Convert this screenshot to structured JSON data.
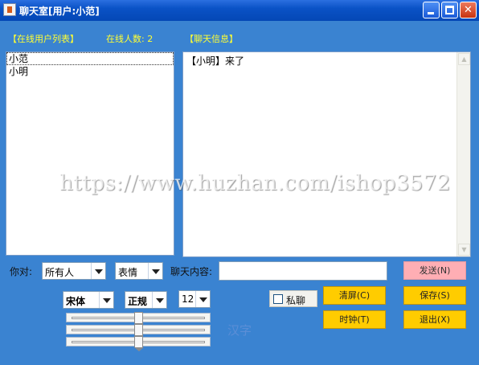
{
  "window": {
    "title": "聊天室[用户:小范]"
  },
  "labels": {
    "user_list": "【在线用户列表】",
    "online_count": "在线人数: 2",
    "chat_info": "【聊天信息】",
    "to": "你对:",
    "content": "聊天内容:"
  },
  "users": [
    "小范",
    "小明"
  ],
  "chat": {
    "text": "【小明】来了"
  },
  "watermark": "https://www.huzhan.com/ishop3572",
  "combos": {
    "to": "所有人",
    "emoji": "表情",
    "font": "宋体",
    "style": "正规",
    "size": "12"
  },
  "message_input": {
    "value": ""
  },
  "sliders": {
    "r": 0.5,
    "g": 0.5,
    "b": 0.5
  },
  "preview": "汉字",
  "private_chat": {
    "label": "私聊",
    "checked": false
  },
  "buttons": {
    "send": "发送(N)",
    "clear": "清屏(C)",
    "save": "保存(S)",
    "clock": "时钟(T)",
    "exit": "退出(X)"
  },
  "colors": {
    "background": "#3a83d1",
    "label_yellow": "#ffff33",
    "button_yellow": "#ffcc00",
    "send_pink": "#ffaeb4"
  }
}
